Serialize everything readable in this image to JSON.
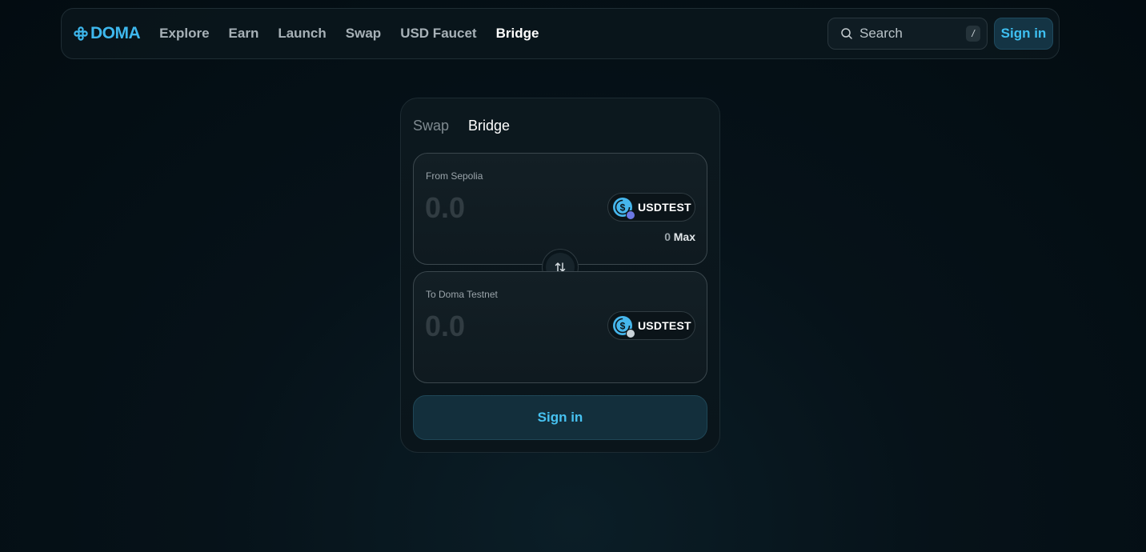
{
  "brand": {
    "name": "DOMA"
  },
  "nav": {
    "links": [
      "Explore",
      "Earn",
      "Launch",
      "Swap",
      "USD Faucet",
      "Bridge"
    ],
    "active": "Bridge",
    "search_label": "Search",
    "search_shortcut": "/",
    "signin_label": "Sign in"
  },
  "bridge": {
    "tabs": [
      "Swap",
      "Bridge"
    ],
    "active_tab": "Bridge",
    "from": {
      "label": "From Sepolia",
      "amount_placeholder": "0.0",
      "token": "USDTEST",
      "balance": "0",
      "max_label": "Max"
    },
    "to": {
      "label": "To Doma Testnet",
      "amount_placeholder": "0.0",
      "token": "USDTEST"
    },
    "signin_label": "Sign in"
  },
  "colors": {
    "accent": "#3eb8ee",
    "background": "#030c11",
    "button_bg": "#132f3c"
  }
}
